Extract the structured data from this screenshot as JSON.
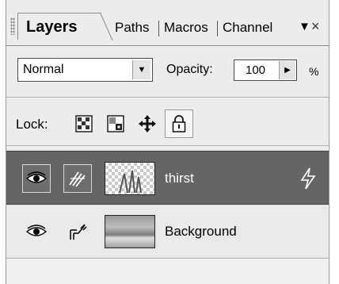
{
  "tabs": [
    {
      "label": "Layers",
      "active": true
    },
    {
      "label": "Paths",
      "active": false
    },
    {
      "label": "Macros",
      "active": false
    },
    {
      "label": "Channel",
      "active": false
    }
  ],
  "tab_controls": {
    "menu_icon": "menu-arrow-icon",
    "close_icon": "close-icon",
    "menu_glyph": "▼",
    "close_glyph": "×"
  },
  "blend": {
    "selected": "Normal",
    "dropdown_glyph": "▼"
  },
  "opacity": {
    "label": "Opacity:",
    "value": "100",
    "unit": "%",
    "spin_glyph": "▶"
  },
  "lock": {
    "label": "Lock:",
    "buttons": [
      {
        "icon": "lock-transparency-icon"
      },
      {
        "icon": "lock-image-icon"
      },
      {
        "icon": "lock-position-icon"
      },
      {
        "icon": "lock-all-icon"
      }
    ]
  },
  "layers": [
    {
      "name": "thirst",
      "selected": true,
      "visible_icon": "eye-icon",
      "link_icon": "brush-icon",
      "thumbnail": "transparent",
      "extra_icon": "lightning-icon"
    },
    {
      "name": "Background",
      "selected": false,
      "visible_icon": "eye-icon",
      "link_icon": "link-icon",
      "thumbnail": "photo"
    }
  ],
  "colors": {
    "panel_bg": "#ececec",
    "selected_row": "#656565",
    "selected_text": "#ffffff"
  }
}
